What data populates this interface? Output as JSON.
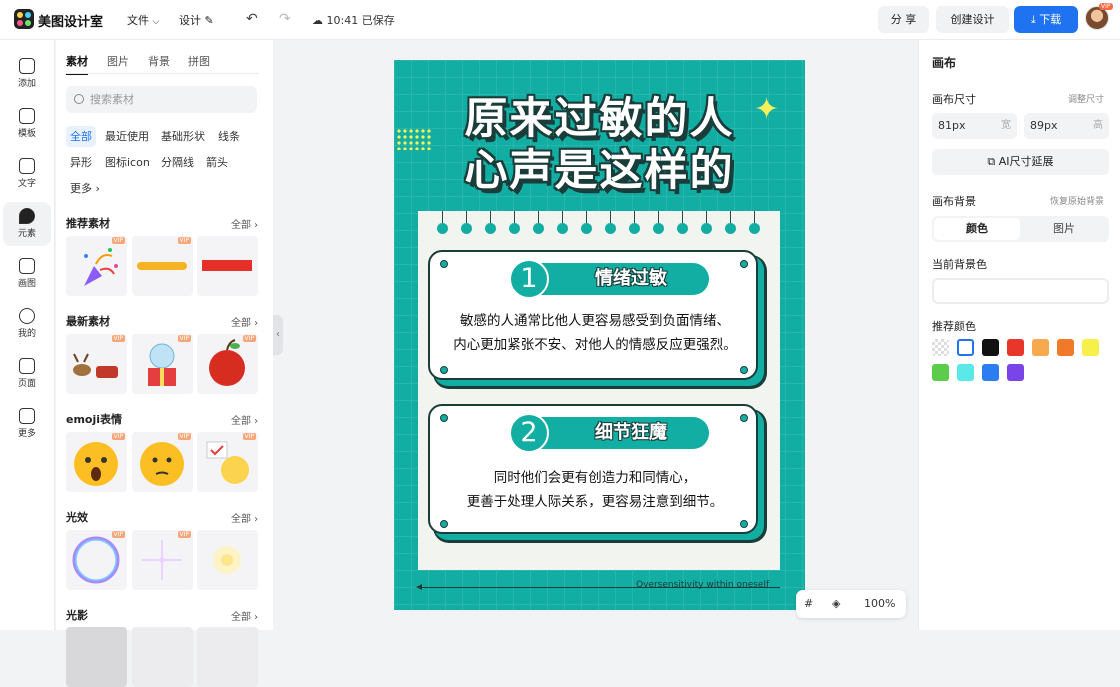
{
  "topbar": {
    "app_name": "美图设计室",
    "menu_file": "文件",
    "menu_design": "设计",
    "save_status": "10:41 已保存",
    "share_label": "分 享",
    "create_label": "创建设计",
    "download_label": "下载",
    "vip_badge": "VIP"
  },
  "nav": [
    {
      "label": "添加",
      "icon": "plus-icon"
    },
    {
      "label": "模板",
      "icon": "template-icon"
    },
    {
      "label": "文字",
      "icon": "text-icon"
    },
    {
      "label": "元素",
      "icon": "shapes-icon"
    },
    {
      "label": "画图",
      "icon": "pen-icon"
    },
    {
      "label": "我的",
      "icon": "user-icon"
    },
    {
      "label": "页面",
      "icon": "page-add-icon"
    },
    {
      "label": "更多",
      "icon": "cube-icon"
    }
  ],
  "panel": {
    "tabs": [
      "素材",
      "图片",
      "背景",
      "拼图"
    ],
    "search_placeholder": "搜索素材",
    "chips": [
      "全部",
      "最近使用",
      "基础形状",
      "线条",
      "异形",
      "图标icon",
      "分隔线",
      "箭头",
      "更多"
    ],
    "sections": [
      {
        "title": "推荐素材",
        "all": "全部"
      },
      {
        "title": "最新素材",
        "all": "全部"
      },
      {
        "title": "emoji表情",
        "all": "全部"
      },
      {
        "title": "光效",
        "all": "全部"
      },
      {
        "title": "光影",
        "all": "全部"
      }
    ],
    "vip": "VIP"
  },
  "poster": {
    "title_line1": "原来过敏的人",
    "title_line2": "心声是这样的",
    "card1": {
      "num": "1",
      "heading": "情绪过敏",
      "line1": "敏感的人通常比他人更容易感受到负面情绪、",
      "line2": "内心更加紧张不安、对他人的情感反应更强烈。"
    },
    "card2": {
      "num": "2",
      "heading": "细节狂魔",
      "line1": "同时他们会更有创造力和同情心，",
      "line2": "更善于处理人际关系，更容易注意到细节。"
    },
    "footer_text": "Oversensitivity within oneself",
    "colors": {
      "bg": "#13aea3",
      "paper": "#f1f4ef",
      "ink": "#1a3d3a",
      "accent": "#f6f05a"
    }
  },
  "zoom": {
    "value": "100%"
  },
  "right": {
    "title": "画布",
    "size_label": "画布尺寸",
    "size_adjust": "调整尺寸",
    "width_value": "81px",
    "width_unit": "宽",
    "height_value": "89px",
    "height_unit": "高",
    "ai_extend": "AI尺寸延展",
    "bg_label": "画布背景",
    "bg_restore": "恢复原始背景",
    "seg_color": "颜色",
    "seg_image": "图片",
    "current_bg": "当前背景色",
    "recommend": "推荐颜色",
    "swatches": [
      "transparent",
      "#ffffff",
      "#111111",
      "#e8372a",
      "#f6a94e",
      "#f07a2a",
      "#f8f04a",
      "#5ccd4a",
      "#5ae8e8",
      "#2b7df0",
      "#7a45e8"
    ]
  }
}
